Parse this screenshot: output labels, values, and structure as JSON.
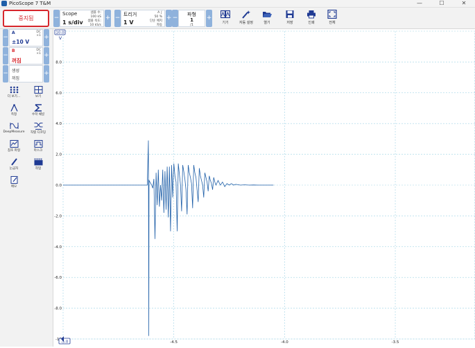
{
  "window": {
    "title": "PicoScope 7 T&M"
  },
  "toolbar": {
    "stop_label": "중지됨",
    "scope": {
      "title": "Scope",
      "value": "1 s/div",
      "line1": "샘플 수:",
      "line2": "100 kS",
      "line3": "샘플 속도:",
      "line4": "10 kS/s"
    },
    "trigger": {
      "title": "트리거",
      "value": "1 V",
      "line1": "A  ∫",
      "line2": "50 %",
      "line3": "단순 에지",
      "line4": "자동"
    },
    "waveform": {
      "title": "파형",
      "value": "1",
      "count": "/1"
    },
    "tools": [
      {
        "label": "기기",
        "icon": "instruments-icon"
      },
      {
        "label": "자동 설정",
        "icon": "auto-setup-icon"
      },
      {
        "label": "열기",
        "icon": "folder-open-icon"
      },
      {
        "label": "저장",
        "icon": "save-icon"
      },
      {
        "label": "인쇄",
        "icon": "print-icon"
      },
      {
        "label": "전체",
        "icon": "fullscreen-icon"
      }
    ]
  },
  "channels": {
    "a": {
      "name": "A",
      "coupling1": "DC",
      "coupling2": "×1",
      "range": "±10 V",
      "color": "#1f3a93"
    },
    "b": {
      "name": "B",
      "coupling1": "DC",
      "coupling2": "×1",
      "range": "꺼짐",
      "color": "#d7262c"
    },
    "c": {
      "line1": "생성",
      "line2": "꺼짐"
    }
  },
  "sidebar_tools": [
    {
      "label": "더 보기...",
      "icon": "more-grid-icon"
    },
    {
      "label": "보기",
      "icon": "view-icon"
    },
    {
      "label": "측정",
      "icon": "measure-icon"
    },
    {
      "label": "수학 채널",
      "icon": "sigma-icon"
    },
    {
      "label": "DeepMeasure",
      "icon": "deepmeasure-icon"
    },
    {
      "label": "직렬 디코딩",
      "icon": "serial-decode-icon"
    },
    {
      "label": "참조 파형",
      "icon": "reference-waveform-icon"
    },
    {
      "label": "마스크",
      "icon": "mask-icon"
    },
    {
      "label": "눈금자",
      "icon": "ruler-icon"
    },
    {
      "label": "작업",
      "icon": "actions-icon"
    },
    {
      "label": "메모",
      "icon": "notes-icon"
    }
  ],
  "plot": {
    "axis_unit": "V",
    "axis_scale_badge": "10.0",
    "x_start_badge": "-5.0",
    "x_ticks": [
      "-4.5",
      "-4.0",
      "-3.5"
    ],
    "y_ticks": [
      "8.0",
      "6.0",
      "4.0",
      "2.0",
      "0.0",
      "-2.0",
      "-4.0",
      "-6.0",
      "-8.0",
      "-10"
    ],
    "trace_color": "#1f5fa8",
    "grid_color": "#9fd3e6"
  },
  "chart_data": {
    "type": "line",
    "xlabel": "",
    "ylabel": "V",
    "xlim": [
      -5.0,
      -3.14
    ],
    "ylim": [
      -10.0,
      10.0
    ],
    "x_ticks": [
      -4.5,
      -4.0,
      -3.5
    ],
    "y_ticks": [
      8,
      6,
      4,
      2,
      0,
      -2,
      -4,
      -6,
      -8,
      -10
    ],
    "series": [
      {
        "x": [
          -5.0,
          -4.62,
          -4.615,
          -4.614,
          -4.613,
          -4.612,
          -4.6,
          -4.595,
          -4.59,
          -4.585,
          -4.58,
          -4.575,
          -4.57,
          -4.565,
          -4.56,
          -4.555,
          -4.55,
          -4.545,
          -4.54,
          -4.535,
          -4.53,
          -4.525,
          -4.52,
          -4.515,
          -4.51,
          -4.505,
          -4.5,
          -4.495,
          -4.49,
          -4.485,
          -4.48,
          -4.475,
          -4.47,
          -4.465,
          -4.46,
          -4.455,
          -4.45,
          -4.445,
          -4.44,
          -4.435,
          -4.43,
          -4.425,
          -4.42,
          -4.415,
          -4.41,
          -4.405,
          -4.4,
          -4.395,
          -4.39,
          -4.385,
          -4.38,
          -4.375,
          -4.37,
          -4.365,
          -4.36,
          -4.355,
          -4.35,
          -4.345,
          -4.34,
          -4.335,
          -4.33,
          -4.325,
          -4.32,
          -4.315,
          -4.31,
          -4.3,
          -4.29,
          -4.28,
          -4.27,
          -4.26,
          -4.25,
          -4.24,
          -4.23,
          -4.22,
          -4.2,
          -4.18,
          -4.16,
          -4.14,
          -4.12,
          -4.1,
          -4.05
        ],
        "y": [
          0.0,
          0.0,
          2.9,
          -3.5,
          -9.8,
          0.3,
          0.0,
          -0.2,
          0.4,
          -3.5,
          0.8,
          -1.3,
          1.0,
          -1.4,
          0.0,
          -1.0,
          1.0,
          -1.8,
          0.9,
          -1.6,
          1.2,
          -2.1,
          1.2,
          -3.0,
          1.3,
          -0.8,
          1.4,
          0.6,
          0.2,
          -3.0,
          1.4,
          0.7,
          0.0,
          -1.7,
          1.3,
          0.9,
          0.4,
          -0.3,
          -1.9,
          1.3,
          0.8,
          0.5,
          0.1,
          -1.5,
          1.3,
          0.8,
          0.5,
          -0.3,
          -1.1,
          1.1,
          0.6,
          0.3,
          0.0,
          -0.8,
          0.8,
          0.5,
          0.2,
          -0.4,
          0.6,
          0.3,
          0.1,
          -0.3,
          0.5,
          0.2,
          0.0,
          0.3,
          0.0,
          0.2,
          -0.1,
          0.1,
          0.0,
          0.1,
          0.0,
          0.05,
          0.0,
          0.02,
          0.0,
          0.01,
          0.0,
          0.0,
          0.0
        ]
      }
    ]
  }
}
